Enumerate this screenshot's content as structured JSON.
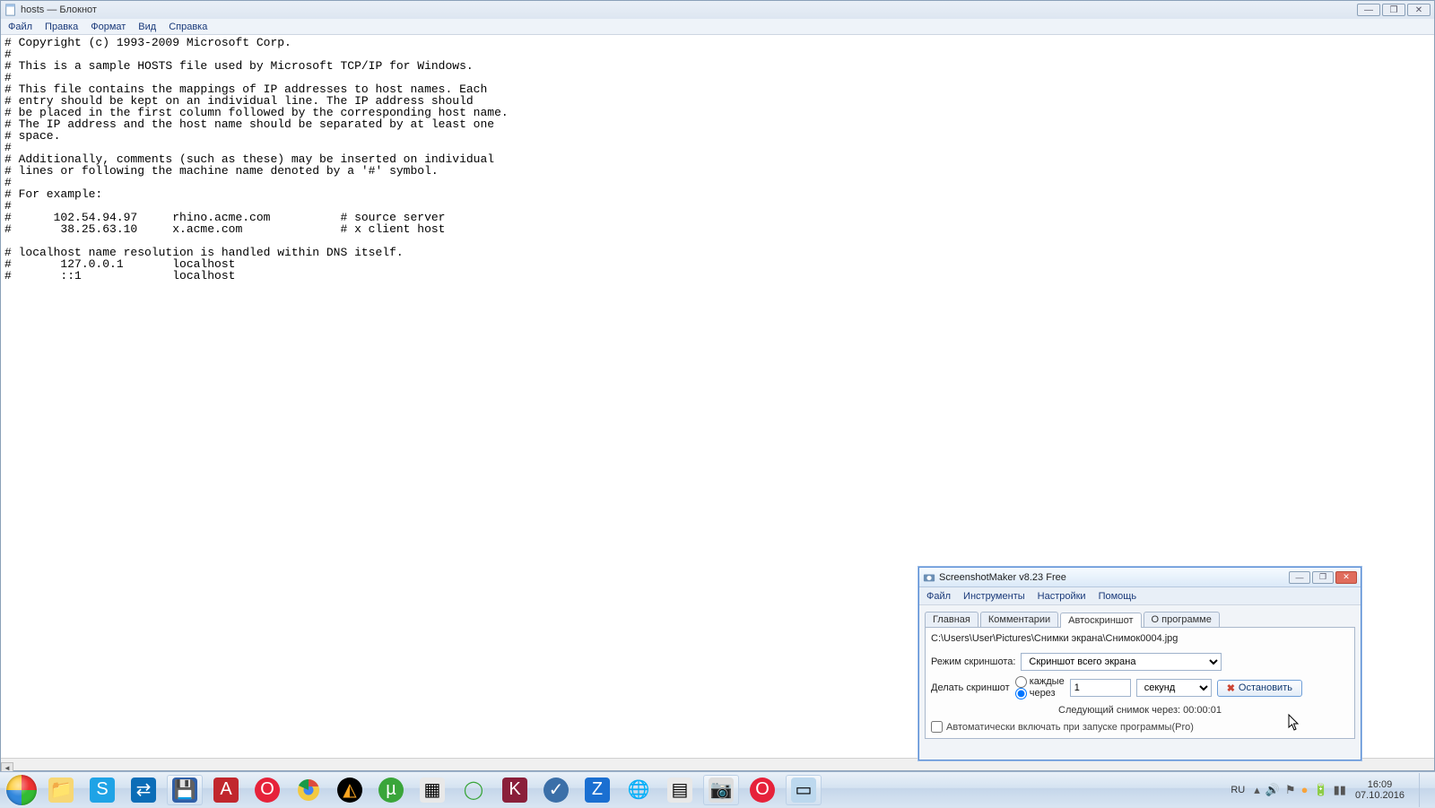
{
  "notepad": {
    "title": "hosts — Блокнот",
    "menu": [
      "Файл",
      "Правка",
      "Формат",
      "Вид",
      "Справка"
    ],
    "content": "# Copyright (c) 1993-2009 Microsoft Corp.\n#\n# This is a sample HOSTS file used by Microsoft TCP/IP for Windows.\n#\n# This file contains the mappings of IP addresses to host names. Each\n# entry should be kept on an individual line. The IP address should\n# be placed in the first column followed by the corresponding host name.\n# The IP address and the host name should be separated by at least one\n# space.\n#\n# Additionally, comments (such as these) may be inserted on individual\n# lines or following the machine name denoted by a '#' symbol.\n#\n# For example:\n#\n#      102.54.94.97     rhino.acme.com          # source server\n#       38.25.63.10     x.acme.com              # x client host\n\n# localhost name resolution is handled within DNS itself.\n#       127.0.0.1       localhost\n#       ::1             localhost"
  },
  "dlg": {
    "title": "ScreenshotMaker v8.23 Free",
    "menu": [
      "Файл",
      "Инструменты",
      "Настройки",
      "Помощь"
    ],
    "tabs": [
      "Главная",
      "Комментарии",
      "Автоскриншот",
      "О программе"
    ],
    "active_tab": 2,
    "path": "C:\\Users\\User\\Pictures\\Снимки экрана\\Снимок0004.jpg",
    "mode_label": "Режим скриншота:",
    "mode_value": "Скриншот всего экрана",
    "make_label": "Делать скриншот",
    "radio_every": "каждые",
    "radio_after": "через",
    "interval_value": "1",
    "unit_value": "секунд",
    "stop_label": "Остановить",
    "next_label": "Следующий снимок через: 00:00:01",
    "autorun_label": "Автоматически включать при запуске программы(Pro)"
  },
  "tray": {
    "lang": "RU",
    "time": "16:09",
    "date": "07.10.2016"
  },
  "taskbar_items": [
    "explorer",
    "skype",
    "teamviewer",
    "notepad",
    "adobe-reader",
    "opera",
    "chrome",
    "aimp",
    "utorrent",
    "calendar",
    "green-app",
    "k-app",
    "vkontakte",
    "zona",
    "globe",
    "window-list",
    "screenshotmaker",
    "opera2",
    "explorer-window"
  ]
}
